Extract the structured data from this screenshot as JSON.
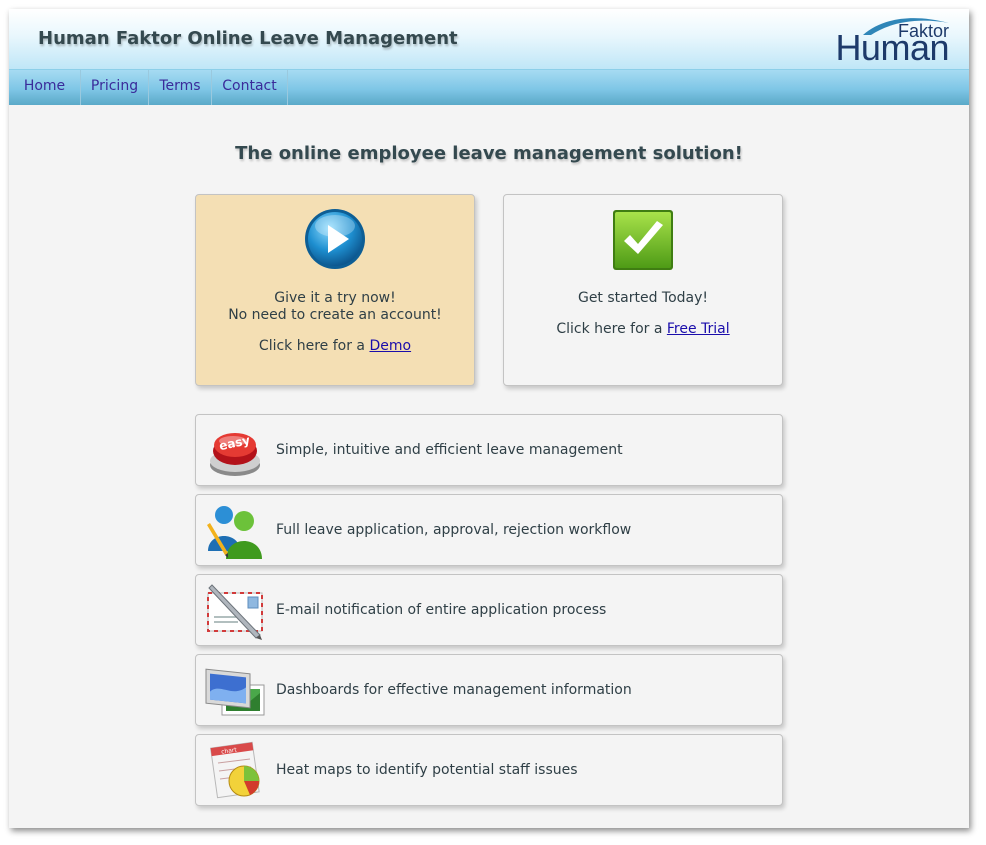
{
  "header": {
    "title": "Human Faktor Online Leave Management",
    "logo": {
      "line1": "Faktor",
      "line2": "Human"
    }
  },
  "nav": {
    "items": [
      {
        "label": "Home"
      },
      {
        "label": "Pricing"
      },
      {
        "label": "Terms"
      },
      {
        "label": "Contact"
      }
    ]
  },
  "main": {
    "tagline": "The online employee leave management solution!",
    "demo_card": {
      "icon": "play-icon",
      "line1": "Give it a try now!",
      "line2": "No need to create an account!",
      "prefix": "Click here for a ",
      "link": "Demo"
    },
    "trial_card": {
      "icon": "checkmark-icon",
      "line1": "Get started Today!",
      "prefix": "Click here for a ",
      "link": "Free Trial"
    },
    "features": [
      {
        "icon": "easy-button-icon",
        "icon_label": "easy",
        "text": "Simple, intuitive and efficient leave management"
      },
      {
        "icon": "users-icon",
        "text": "Full leave application, approval, rejection workflow"
      },
      {
        "icon": "email-icon",
        "text": "E-mail notification of entire application process"
      },
      {
        "icon": "dashboard-icon",
        "text": "Dashboards for effective management information"
      },
      {
        "icon": "chart-icon",
        "icon_label": "chart",
        "text": "Heat maps to identify potential staff issues"
      }
    ]
  },
  "colors": {
    "nav_link": "#3a2b9a",
    "demo_card_bg": "#f4dfb4",
    "heading": "#34494f",
    "link": "#1a0dab"
  }
}
